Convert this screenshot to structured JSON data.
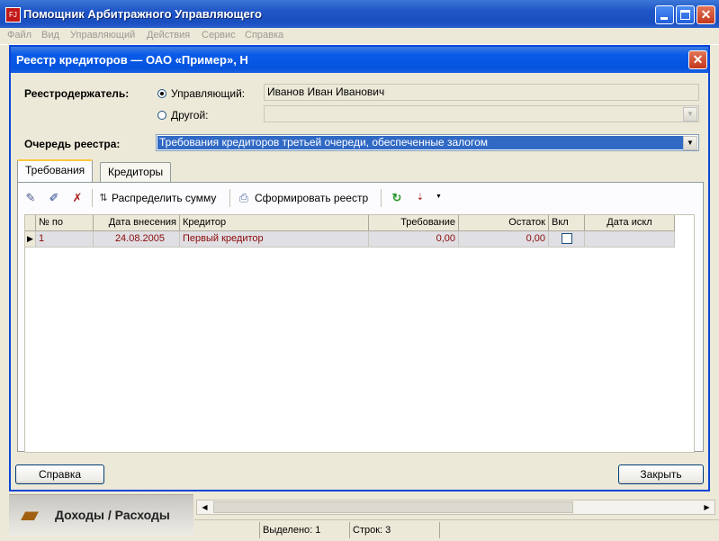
{
  "app": {
    "title": "Помощник Арбитражного Управляющего",
    "icon_text": "FJ"
  },
  "menu": [
    "Файл",
    "Вид",
    "Управляющий",
    "Действия",
    "Сервис",
    "Справка"
  ],
  "dialog": {
    "title": "Реестр кредиторов — ОАО «Пример», Н",
    "holder_label": "Реестродержатель:",
    "radio_manager": "Управляющий:",
    "manager_value": "Иванов Иван Иванович",
    "radio_other": "Другой:",
    "queue_label": "Очередь реестра:",
    "queue_value": "Требования кредиторов третьей очереди, обеспеченные залогом",
    "tabs": [
      "Требования",
      "Кредиторы"
    ],
    "toolbar": {
      "distribute": "Распределить сумму",
      "form_registry": "Сформировать реестр"
    },
    "grid": {
      "headers": [
        "№ по",
        "Дата внесения",
        "Кредитор",
        "Требование",
        "Остаток",
        "Вкл",
        "Дата искл"
      ],
      "rows": [
        {
          "no": "1",
          "date": "24.08.2005",
          "creditor": "Первый кредитор",
          "claim": "0,00",
          "rest": "0,00",
          "included": false,
          "excl_date": ""
        }
      ]
    },
    "help_button": "Справка",
    "close_button": "Закрыть"
  },
  "outlook": {
    "label": "Доходы / Расходы"
  },
  "status": {
    "selected": "Выделено: 1",
    "rows": "Строк: 3"
  },
  "colors": {
    "title_blue": "#0a5be8",
    "row_text": "#8a0a0a",
    "tab_highlight": "#ffc83c"
  }
}
